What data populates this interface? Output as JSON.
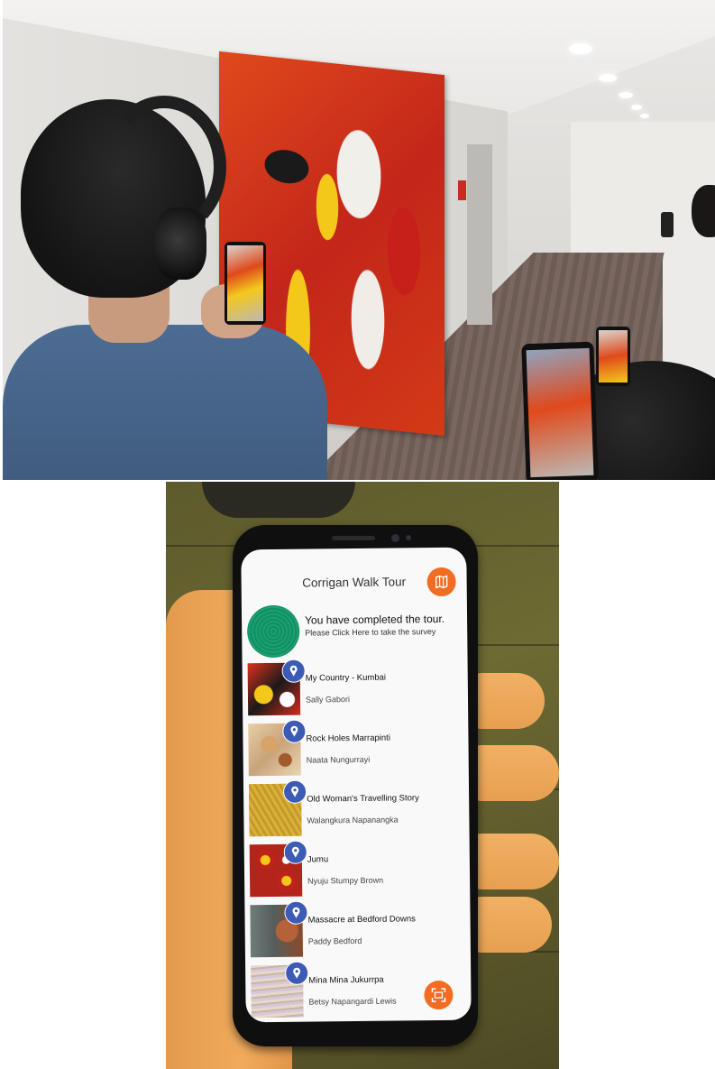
{
  "app": {
    "title": "Corrigan Walk Tour",
    "icons": {
      "map": "map-icon",
      "scan": "scan-icon",
      "completed_badge": "concentric-circle-badge",
      "pin": "location-pin-icon"
    },
    "accent_color": "#f26d21",
    "pin_color": "#3c5bb5"
  },
  "completion": {
    "title": "You have completed the tour.",
    "subtitle": "Please Click Here to take the survey"
  },
  "artworks": [
    {
      "title": "My Country - Kumbai",
      "artist": "Sally Gabori"
    },
    {
      "title": "Rock Holes Marrapinti",
      "artist": "Naata Nungurrayi"
    },
    {
      "title": "Old Woman's Travelling Story",
      "artist": "Walangkura Napanangka"
    },
    {
      "title": "Jumu",
      "artist": "Nyuju Stumpy Brown"
    },
    {
      "title": "Massacre at Bedford Downs",
      "artist": "Paddy Bedford"
    },
    {
      "title": "Mina Mina Jukurrpa",
      "artist": "Betsy Napangardi Lewis"
    }
  ]
}
